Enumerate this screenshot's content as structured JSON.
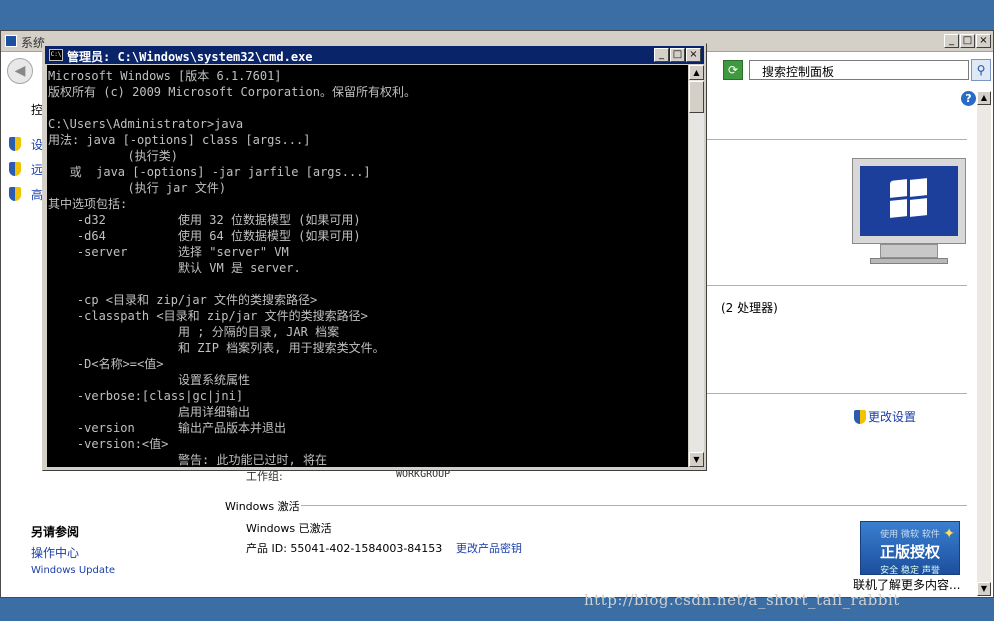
{
  "background_window": {
    "title": "系统",
    "window_buttons": [
      "_",
      "□",
      "×"
    ],
    "refresh_glyph": "⟳",
    "search_placeholder": "搜索控制面板",
    "search_glyph": "⚲",
    "help_glyph": "?",
    "left_nav": {
      "heading": "控",
      "items": [
        "设",
        "远",
        "高"
      ]
    },
    "processor_text": "(2 处理器)",
    "change_settings": "更改设置",
    "workgroup_label": "工作组:",
    "workgroup_value": "WORKGROUP",
    "activation_section": "Windows 激活",
    "activation_status": "Windows 已激活",
    "product_id": "产品 ID: 55041-402-1584003-84153",
    "change_product_key": "更改产品密钥",
    "see_also": {
      "heading": "另请参阅",
      "links": [
        "操作中心",
        "Windows Update"
      ]
    },
    "genuine_badge": {
      "line1": "使用 微软 软件",
      "line2": "正版授权",
      "line3": "安全 稳定 声誉"
    },
    "learn_more": "联机了解更多内容...",
    "watermark": "http://blog.csdn.net/a_short_tail_rabbit"
  },
  "cmd_window": {
    "title": "管理员: C:\\Windows\\system32\\cmd.exe",
    "icon_text": "C:\\",
    "window_buttons": [
      "_",
      "□",
      "×"
    ],
    "console_text": "Microsoft Windows [版本 6.1.7601]\n版权所有 (c) 2009 Microsoft Corporation。保留所有权利。\n\nC:\\Users\\Administrator>java\n用法: java [-options] class [args...]\n           (执行类)\n   或  java [-options] -jar jarfile [args...]\n           (执行 jar 文件)\n其中选项包括:\n    -d32          使用 32 位数据模型 (如果可用)\n    -d64          使用 64 位数据模型 (如果可用)\n    -server       选择 \"server\" VM\n                  默认 VM 是 server.\n\n    -cp <目录和 zip/jar 文件的类搜索路径>\n    -classpath <目录和 zip/jar 文件的类搜索路径>\n                  用 ; 分隔的目录, JAR 档案\n                  和 ZIP 档案列表, 用于搜索类文件。\n    -D<名称>=<值>\n                  设置系统属性\n    -verbose:[class|gc|jni]\n                  启用详细输出\n    -version      输出产品版本并退出\n    -version:<值>\n                  警告: 此功能已过时, 将在"
  }
}
